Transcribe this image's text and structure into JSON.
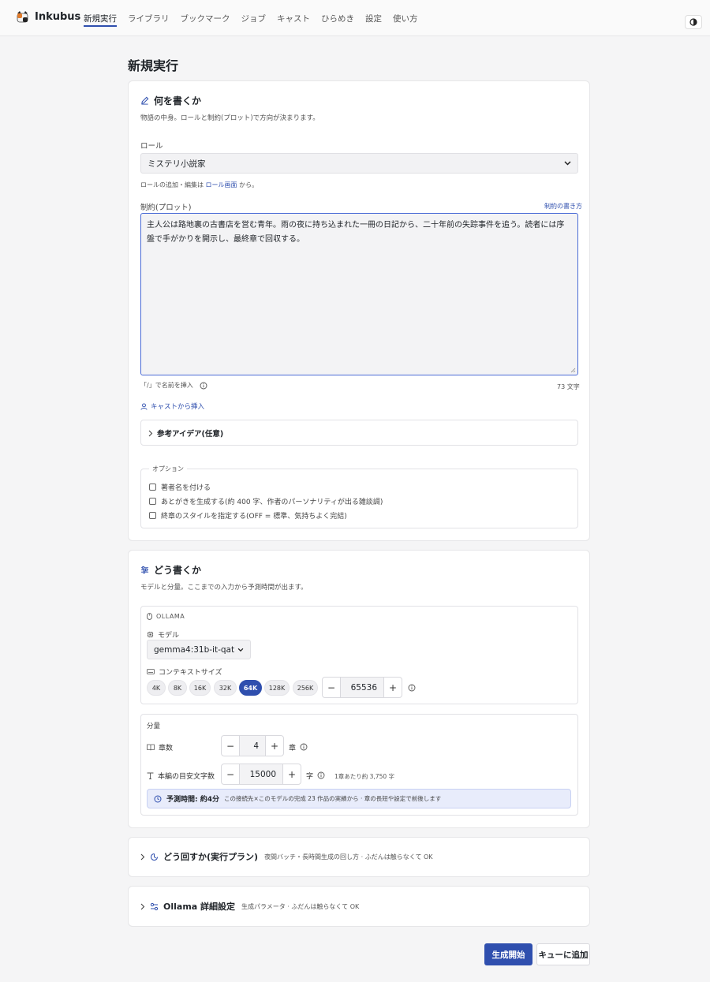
{
  "app": {
    "name": "Inkubus"
  },
  "nav": [
    {
      "label": "新規実行"
    },
    {
      "label": "ライブラリ"
    },
    {
      "label": "ブックマーク"
    },
    {
      "label": "ジョブ"
    },
    {
      "label": "キャスト"
    },
    {
      "label": "ひらめき"
    },
    {
      "label": "設定"
    },
    {
      "label": "使い方"
    }
  ],
  "page": {
    "title": "新規実行"
  },
  "what": {
    "title": "何を書くか",
    "subtitle": "物語の中身。ロールと制約(プロット)で方向が決まります。",
    "role_label": "ロール",
    "role_value": "ミステリ小説家",
    "role_hint_prefix": "ロールの追加・編集は",
    "role_hint_link": "ロール画面",
    "role_hint_suffix": "から。",
    "plot_label": "制約(プロット)",
    "plot_help_link": "制約の書き方",
    "plot_value": "主人公は路地裏の古書店を営む青年。雨の夜に持ち込まれた一冊の日記から、二十年前の失踪事件を追う。読者には序盤で手がかりを開示し、最終章で回収する。",
    "insert_hint": "「/」で名前を挿入",
    "char_count": "73 文字",
    "cast_insert": "キャストから挿入",
    "ideas_label": "参考アイデア(任意)",
    "options_legend": "オプション",
    "options": [
      {
        "label": "著者名を付ける"
      },
      {
        "label": "あとがきを生成する(約 400 字、作者のパーソナリティが出る雑談調)"
      },
      {
        "label": "終章のスタイルを指定する(OFF = 標準、気持ちよく完結)"
      }
    ]
  },
  "how": {
    "title": "どう書くか",
    "subtitle": "モデルと分量。ここまでの入力から予測時間が出ます。",
    "provider": "OLLAMA",
    "model_label": "モデル",
    "model_value": "gemma4:31b-it-qat",
    "context_label": "コンテキストサイズ",
    "context_chips": [
      "4K",
      "8K",
      "16K",
      "32K",
      "64K",
      "128K",
      "256K"
    ],
    "context_active": "64K",
    "context_value": "65536",
    "volume_label": "分量",
    "chapters_label": "章数",
    "chapters_value": "4",
    "chapters_unit": "章",
    "length_label": "本編の目安文字数",
    "length_value": "15000",
    "length_unit": "字",
    "per_chapter": "1章あたり約 3,750 字",
    "estimate_label": "予測時間: 約4分",
    "estimate_detail": "この接続先×このモデルの完成 23 作品の実績から · 章の長短や設定で前後します"
  },
  "plan": {
    "title": "どう回すか(実行プラン)",
    "subtitle": "夜間バッチ・長時間生成の回し方 · ふだんは触らなくて OK"
  },
  "ollama": {
    "title": "Ollama 詳細設定",
    "subtitle": "生成パラメータ · ふだんは触らなくて OK"
  },
  "actions": {
    "start": "生成開始",
    "queue": "キューに追加"
  },
  "colors": {
    "accent": "#2f4fae",
    "estimate_bg": "#e8ecfb"
  }
}
